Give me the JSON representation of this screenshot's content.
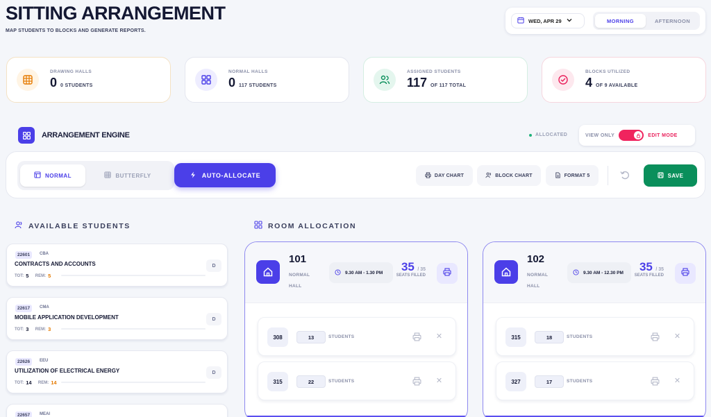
{
  "header": {
    "title": "SITTING ARRANGEMENT",
    "subtitle": "MAP STUDENTS TO BLOCKS AND GENERATE REPORTS."
  },
  "topbar": {
    "date": "WED, APR 29",
    "shifts": [
      "MORNING",
      "AFTERNOON"
    ],
    "active_shift": "MORNING"
  },
  "stats": [
    {
      "label": "DRAWING HALLS",
      "value": "0",
      "sub": "0 STUDENTS",
      "icon": "grid-icon",
      "color": "#e57a00"
    },
    {
      "label": "NORMAL HALLS",
      "value": "0",
      "sub": "117 STUDENTS",
      "icon": "apps-icon",
      "color": "#4b3fe8"
    },
    {
      "label": "ASSIGNED STUDENTS",
      "value": "117",
      "sub": "OF 117 TOTAL",
      "icon": "users-icon",
      "color": "#0a8f5b"
    },
    {
      "label": "BLOCKS UTILIZED",
      "value": "4",
      "sub": "OF 9 AVAILABLE",
      "icon": "check-circle-icon",
      "color": "#e91e5a"
    }
  ],
  "engine": {
    "title": "ARRANGEMENT ENGINE",
    "status": "ALLOCATED",
    "view_only": "VIEW ONLY",
    "edit_mode": "EDIT MODE"
  },
  "toolbar": {
    "normal": "NORMAL",
    "butterfly": "BUTTERFLY",
    "auto_allocate": "AUTO-ALLOCATE",
    "day_chart": "DAY CHART",
    "block_chart": "BLOCK CHART",
    "formats": "FORMAT 5",
    "save": "SAVE"
  },
  "available": {
    "title": "AVAILABLE STUDENTS",
    "tot_label": "TOT:",
    "rem_label": "REM:",
    "students": [
      {
        "code": "22601",
        "abbr": "CBA",
        "name": "CONTRACTS AND ACCOUNTS",
        "tot": "5",
        "rem": "5",
        "d": "D"
      },
      {
        "code": "22617",
        "abbr": "CMA",
        "name": "MOBILE APPLICATION DEVELOPMENT",
        "tot": "3",
        "rem": "3",
        "d": "D"
      },
      {
        "code": "22626",
        "abbr": "EEU",
        "name": "UTILIZATION OF ELECTRICAL ENERGY",
        "tot": "14",
        "rem": "14",
        "d": "D"
      },
      {
        "code": "22657",
        "abbr": "MEAI",
        "name": "",
        "tot": "",
        "rem": "",
        "d": ""
      }
    ]
  },
  "rooms": {
    "title": "ROOM ALLOCATION",
    "students_label": "STUDENTS",
    "seats_filled_label": "SEATS FILLED",
    "list": [
      {
        "number": "101",
        "type": "NORMAL HALL",
        "time": "9.30 AM - 1.30 PM",
        "filled": "35",
        "capacity": "/ 35",
        "blocks": [
          {
            "block": "308",
            "count": "13"
          },
          {
            "block": "315",
            "count": "22"
          }
        ]
      },
      {
        "number": "102",
        "type": "NORMAL HALL",
        "time": "9.30 AM - 12.30 PM",
        "filled": "35",
        "capacity": "/ 35",
        "blocks": [
          {
            "block": "315",
            "count": "18"
          },
          {
            "block": "327",
            "count": "17"
          }
        ]
      }
    ]
  }
}
